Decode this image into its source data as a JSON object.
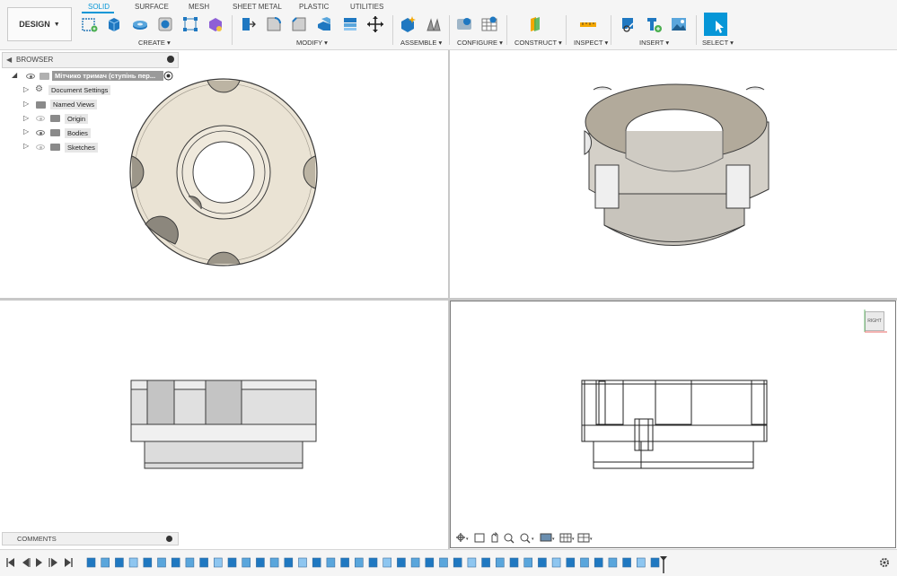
{
  "toolbar": {
    "design_label": "DESIGN",
    "tabs": [
      "SOLID",
      "SURFACE",
      "MESH",
      "SHEET METAL",
      "PLASTIC",
      "UTILITIES"
    ],
    "groups": [
      "CREATE",
      "MODIFY",
      "ASSEMBLE",
      "CONFIGURE",
      "CONSTRUCT",
      "INSPECT",
      "INSERT",
      "SELECT"
    ],
    "accent": "#0696d7",
    "icons": [
      "create-sketch-icon",
      "extrude-icon",
      "revolve-icon",
      "hole-icon",
      "pattern-icon",
      "form-icon",
      "press-pull-icon",
      "fillet-icon",
      "chamfer-icon",
      "shell-icon",
      "combine-icon",
      "move-icon",
      "new-component-icon",
      "joint-icon",
      "configure-icon",
      "configure-table-icon",
      "plane-icon",
      "measure-icon",
      "insert-link-icon",
      "insert-plus-icon",
      "insert-image-icon",
      "select-icon"
    ]
  },
  "browser": {
    "title": "BROWSER",
    "root": "Мітчико тримач (ступінь пер...",
    "items": [
      "Document Settings",
      "Named Views",
      "Origin",
      "Bodies",
      "Sketches"
    ]
  },
  "viewcube": {
    "label": "RIGHT"
  },
  "comments": {
    "title": "COMMENTS"
  },
  "colors": {
    "part_face": "#eae3d4",
    "part_edge": "#3a3a3a",
    "panel_bg": "#f5f5f5"
  }
}
